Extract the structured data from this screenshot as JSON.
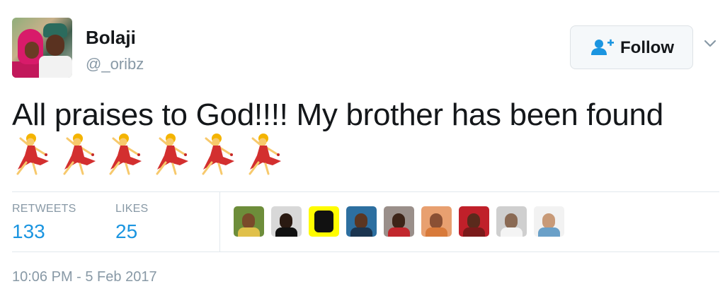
{
  "user": {
    "name": "Bolaji",
    "handle": "@_oribz"
  },
  "actions": {
    "follow_label": "Follow"
  },
  "tweet": {
    "text": "All praises to God!!!! My brother has been found",
    "emoji_count": 6,
    "emoji_icon": "dancer-emoji-icon"
  },
  "stats": {
    "retweets_label": "RETWEETS",
    "retweets_value": "133",
    "likes_label": "LIKES",
    "likes_value": "25"
  },
  "timestamp": "10:06 PM - 5 Feb 2017",
  "colors": {
    "accent": "#1b95e0",
    "muted": "#8899a6",
    "text": "#14171a",
    "border": "#e1e8ed"
  }
}
